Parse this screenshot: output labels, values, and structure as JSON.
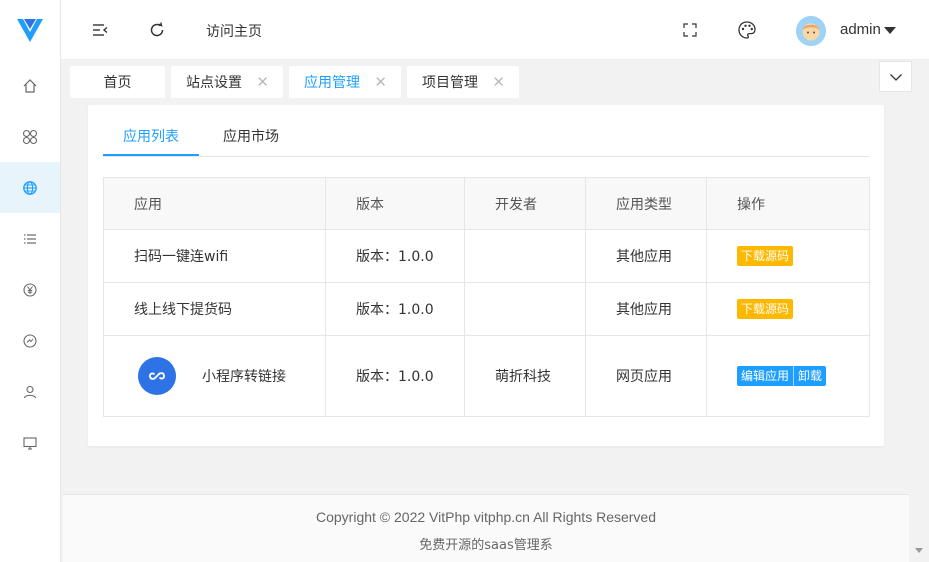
{
  "brand": {
    "accent": "#1e9fff",
    "warn": "#ffb800",
    "logo_color": "#2d73e6"
  },
  "sidebar": {
    "icons": [
      {
        "icon": "home-icon"
      },
      {
        "icon": "apps-icon"
      },
      {
        "icon": "globe-icon",
        "active": true
      },
      {
        "icon": "list-icon"
      },
      {
        "icon": "yen-icon"
      },
      {
        "icon": "dashboard-icon"
      },
      {
        "icon": "user-icon"
      },
      {
        "icon": "monitor-icon"
      }
    ]
  },
  "header": {
    "visit_home": "访问主页",
    "username": "admin"
  },
  "tabs": [
    {
      "label": "首页",
      "closable": false
    },
    {
      "label": "站点设置",
      "closable": true
    },
    {
      "label": "应用管理",
      "closable": true,
      "active": true
    },
    {
      "label": "项目管理",
      "closable": true
    }
  ],
  "subtabs": [
    "应用列表",
    "应用市场"
  ],
  "table": {
    "headers": [
      "应用",
      "版本",
      "开发者",
      "应用类型",
      "操作"
    ],
    "rows": [
      {
        "name": "扫码一键连wifi",
        "version": "版本：1.0.0",
        "developer": "",
        "type": "其他应用",
        "actions": [
          "下载源码"
        ]
      },
      {
        "name": "线上线下提货码",
        "version": "版本：1.0.0",
        "developer": "",
        "type": "其他应用",
        "actions": [
          "下载源码"
        ]
      },
      {
        "name": "小程序转链接",
        "version": "版本：1.0.0",
        "developer": "萌折科技",
        "type": "网页应用",
        "actions": [
          "编辑应用",
          "卸载"
        ]
      }
    ]
  },
  "footer": {
    "copyright": "Copyright © 2022 VitPhp vitphp.cn All Rights Reserved",
    "tagline": "免费开源的saas管理系"
  }
}
